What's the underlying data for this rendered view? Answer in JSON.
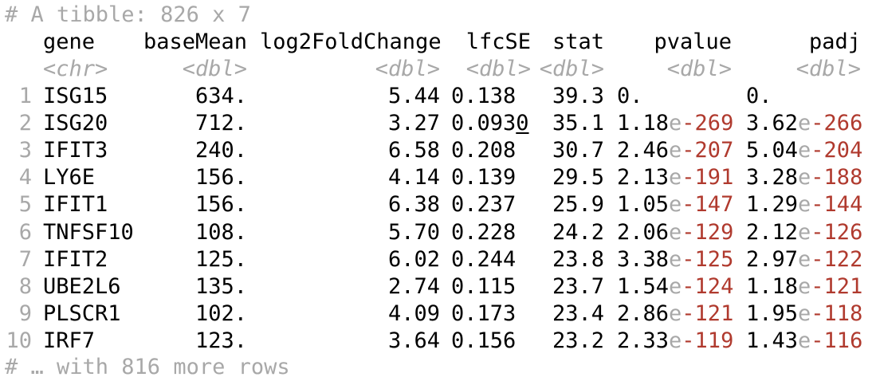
{
  "console": {
    "header": "# A tibble: 826 x 7",
    "footer": "# … with 816 more rows",
    "columns": [
      {
        "name": "gene",
        "type": "<chr>"
      },
      {
        "name": "baseMean",
        "type": "<dbl>"
      },
      {
        "name": "log2FoldChange",
        "type": "<dbl>"
      },
      {
        "name": "lfcSE",
        "type": "<dbl>"
      },
      {
        "name": "stat",
        "type": "<dbl>"
      },
      {
        "name": "pvalue",
        "type": "<dbl>"
      },
      {
        "name": "padj",
        "type": "<dbl>"
      }
    ],
    "rows": [
      {
        "idx": "1",
        "gene": "ISG15",
        "baseMean": "634.",
        "log2FoldChange": "5.44",
        "lfcSE": "0.138",
        "stat": "39.3",
        "pvalue": {
          "mantissa": "0.",
          "exponent": ""
        },
        "padj": {
          "mantissa": "0.",
          "exponent": ""
        }
      },
      {
        "idx": "2",
        "gene": "ISG20",
        "baseMean": "712.",
        "log2FoldChange": "3.27",
        "lfcSE": "0.0930",
        "stat": "35.1",
        "pvalue": {
          "mantissa": "1.18",
          "exponent": "-269"
        },
        "padj": {
          "mantissa": "3.62",
          "exponent": "-266"
        }
      },
      {
        "idx": "3",
        "gene": "IFIT3",
        "baseMean": "240.",
        "log2FoldChange": "6.58",
        "lfcSE": "0.208",
        "stat": "30.7",
        "pvalue": {
          "mantissa": "2.46",
          "exponent": "-207"
        },
        "padj": {
          "mantissa": "5.04",
          "exponent": "-204"
        }
      },
      {
        "idx": "4",
        "gene": "LY6E",
        "baseMean": "156.",
        "log2FoldChange": "4.14",
        "lfcSE": "0.139",
        "stat": "29.5",
        "pvalue": {
          "mantissa": "2.13",
          "exponent": "-191"
        },
        "padj": {
          "mantissa": "3.28",
          "exponent": "-188"
        }
      },
      {
        "idx": "5",
        "gene": "IFIT1",
        "baseMean": "156.",
        "log2FoldChange": "6.38",
        "lfcSE": "0.237",
        "stat": "25.9",
        "pvalue": {
          "mantissa": "1.05",
          "exponent": "-147"
        },
        "padj": {
          "mantissa": "1.29",
          "exponent": "-144"
        }
      },
      {
        "idx": "6",
        "gene": "TNFSF10",
        "baseMean": "108.",
        "log2FoldChange": "5.70",
        "lfcSE": "0.228",
        "stat": "24.2",
        "pvalue": {
          "mantissa": "2.06",
          "exponent": "-129"
        },
        "padj": {
          "mantissa": "2.12",
          "exponent": "-126"
        }
      },
      {
        "idx": "7",
        "gene": "IFIT2",
        "baseMean": "125.",
        "log2FoldChange": "6.02",
        "lfcSE": "0.244",
        "stat": "23.8",
        "pvalue": {
          "mantissa": "3.38",
          "exponent": "-125"
        },
        "padj": {
          "mantissa": "2.97",
          "exponent": "-122"
        }
      },
      {
        "idx": "8",
        "gene": "UBE2L6",
        "baseMean": "135.",
        "log2FoldChange": "2.74",
        "lfcSE": "0.115",
        "stat": "23.7",
        "pvalue": {
          "mantissa": "1.54",
          "exponent": "-124"
        },
        "padj": {
          "mantissa": "1.18",
          "exponent": "-121"
        }
      },
      {
        "idx": "9",
        "gene": "PLSCR1",
        "baseMean": "102.",
        "log2FoldChange": "4.09",
        "lfcSE": "0.173",
        "stat": "23.4",
        "pvalue": {
          "mantissa": "2.86",
          "exponent": "-121"
        },
        "padj": {
          "mantissa": "1.95",
          "exponent": "-118"
        }
      },
      {
        "idx": "10",
        "gene": "IRF7",
        "baseMean": "123.",
        "log2FoldChange": "3.64",
        "lfcSE": "0.156",
        "stat": "23.2",
        "pvalue": {
          "mantissa": "2.33",
          "exponent": "-119"
        },
        "padj": {
          "mantissa": "1.43",
          "exponent": "-116"
        }
      }
    ]
  }
}
